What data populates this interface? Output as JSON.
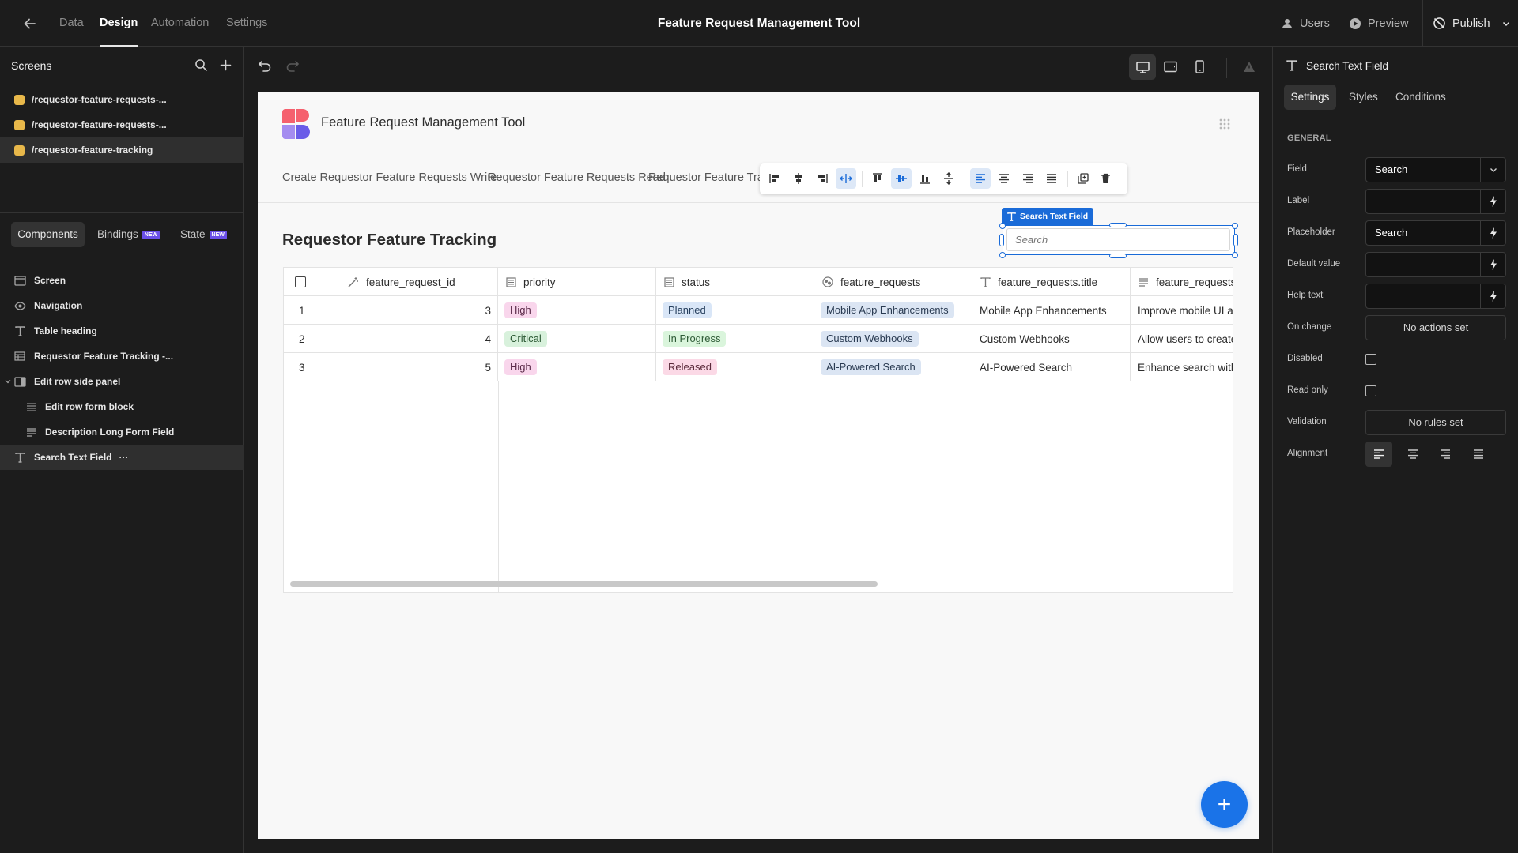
{
  "header": {
    "nav_tabs": [
      "Data",
      "Design",
      "Automation",
      "Settings"
    ],
    "active_tab": "Design",
    "title": "Feature Request Management Tool",
    "users_label": "Users",
    "preview_label": "Preview",
    "publish_label": "Publish"
  },
  "left_panel": {
    "screens_title": "Screens",
    "screens": [
      "/requestor-feature-requests-...",
      "/requestor-feature-requests-...",
      "/requestor-feature-tracking"
    ],
    "selected_screen_index": 2,
    "screen_dot_color": "#e8b84a",
    "tabs": {
      "components": "Components",
      "bindings": "Bindings",
      "state": "State",
      "new_badge": "NEW"
    },
    "tree": [
      {
        "label": "Screen",
        "icon": "screen-icon"
      },
      {
        "label": "Navigation",
        "icon": "eye-icon"
      },
      {
        "label": "Table heading",
        "icon": "text-icon"
      },
      {
        "label": "Requestor Feature Tracking -...",
        "icon": "table-icon"
      },
      {
        "label": "Edit row side panel",
        "icon": "side-panel-icon"
      },
      {
        "label": "Edit row form block",
        "icon": "form-icon"
      },
      {
        "label": "Description Long Form Field",
        "icon": "long-text-icon"
      },
      {
        "label": "Search Text Field",
        "icon": "text-icon"
      }
    ],
    "more_label": "···"
  },
  "canvas": {
    "app_name": "Feature Request Management Tool",
    "nav_links": [
      "Create Requestor Feature Requests Write",
      "Requestor Feature Requests Read",
      "Requestor Feature Tracking"
    ],
    "heading": "Requestor Feature Tracking",
    "selection_tag": "Search Text Field",
    "search_placeholder": "Search",
    "fab_label": "+",
    "accent_color": "#1a73e8",
    "table": {
      "columns": [
        "feature_request_id",
        "priority",
        "status",
        "feature_requests",
        "feature_requests.title",
        "feature_requests"
      ],
      "rows": [
        {
          "index": "1",
          "id": "3",
          "priority": "High",
          "status": "Planned",
          "request": "Mobile App Enhancements",
          "title": "Mobile App Enhancements",
          "description": "Improve mobile UI an"
        },
        {
          "index": "2",
          "id": "4",
          "priority": "Critical",
          "status": "In Progress",
          "request": "Custom Webhooks",
          "title": "Custom Webhooks",
          "description": "Allow users to create"
        },
        {
          "index": "3",
          "id": "5",
          "priority": "High",
          "status": "Released",
          "request": "AI-Powered Search",
          "title": "AI-Powered Search",
          "description": "Enhance search with"
        }
      ]
    }
  },
  "right_panel": {
    "component_title": "Search Text Field",
    "tabs": [
      "Settings",
      "Styles",
      "Conditions"
    ],
    "active_tab": "Settings",
    "section": "GENERAL",
    "field_label": "Field",
    "field_value": "Search",
    "label_label": "Label",
    "label_value": "",
    "placeholder_label": "Placeholder",
    "placeholder_value": "Search",
    "default_value_label": "Default value",
    "default_value": "",
    "help_text_label": "Help text",
    "help_text_value": "",
    "on_change_label": "On change",
    "on_change_value": "No actions set",
    "disabled_label": "Disabled",
    "read_only_label": "Read only",
    "validation_label": "Validation",
    "validation_value": "No rules set",
    "alignment_label": "Alignment"
  }
}
